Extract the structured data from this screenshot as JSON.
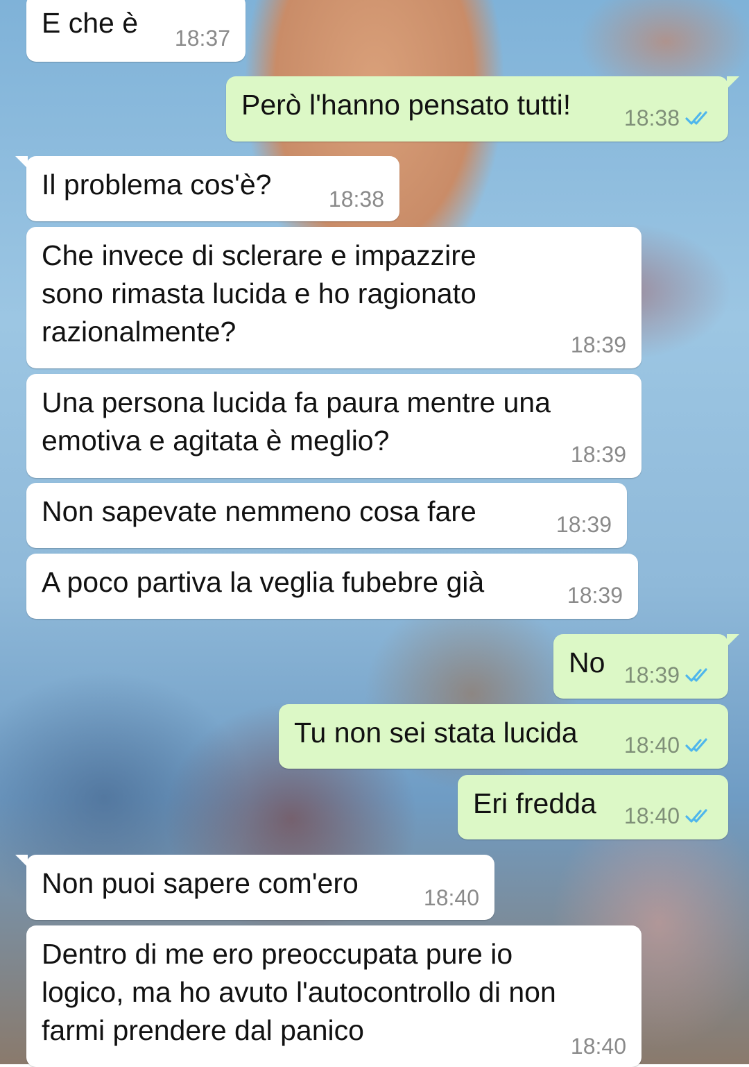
{
  "messages": [
    {
      "text": "E che è",
      "time": "18:37",
      "dir": "in"
    },
    {
      "text": "Però l'hanno pensato tutti!",
      "time": "18:38",
      "dir": "out",
      "read": true
    },
    {
      "text": "Il problema cos'è?",
      "time": "18:38",
      "dir": "in"
    },
    {
      "text": "Che invece di sclerare e impazzire\nsono rimasta lucida e ho ragionato\nrazionalmente?",
      "time": "18:39",
      "dir": "in"
    },
    {
      "text": "Una persona lucida fa paura mentre una\nemotiva e agitata è meglio?",
      "time": "18:39",
      "dir": "in"
    },
    {
      "text": "Non sapevate nemmeno cosa fare",
      "time": "18:39",
      "dir": "in"
    },
    {
      "text": "A poco partiva la veglia fubebre già",
      "time": "18:39",
      "dir": "in"
    },
    {
      "text": "No",
      "time": "18:39",
      "dir": "out",
      "read": true
    },
    {
      "text": "Tu non sei stata lucida",
      "time": "18:40",
      "dir": "out",
      "read": true
    },
    {
      "text": "Eri fredda",
      "time": "18:40",
      "dir": "out",
      "read": true
    },
    {
      "text": "Non puoi sapere com'ero",
      "time": "18:40",
      "dir": "in"
    },
    {
      "text": "Dentro di me ero preoccupata pure io\nlogico, ma ho avuto l'autocontrollo di non\nfarmi prendere dal panico",
      "time": "18:40",
      "dir": "in"
    }
  ],
  "colors": {
    "incoming_bubble": "#ffffff",
    "outgoing_bubble": "#dcf8c6",
    "read_ticks": "#4fb6ec",
    "timestamp": "#8a8a8a"
  },
  "icons": {
    "read_receipt": "double-check-icon"
  }
}
